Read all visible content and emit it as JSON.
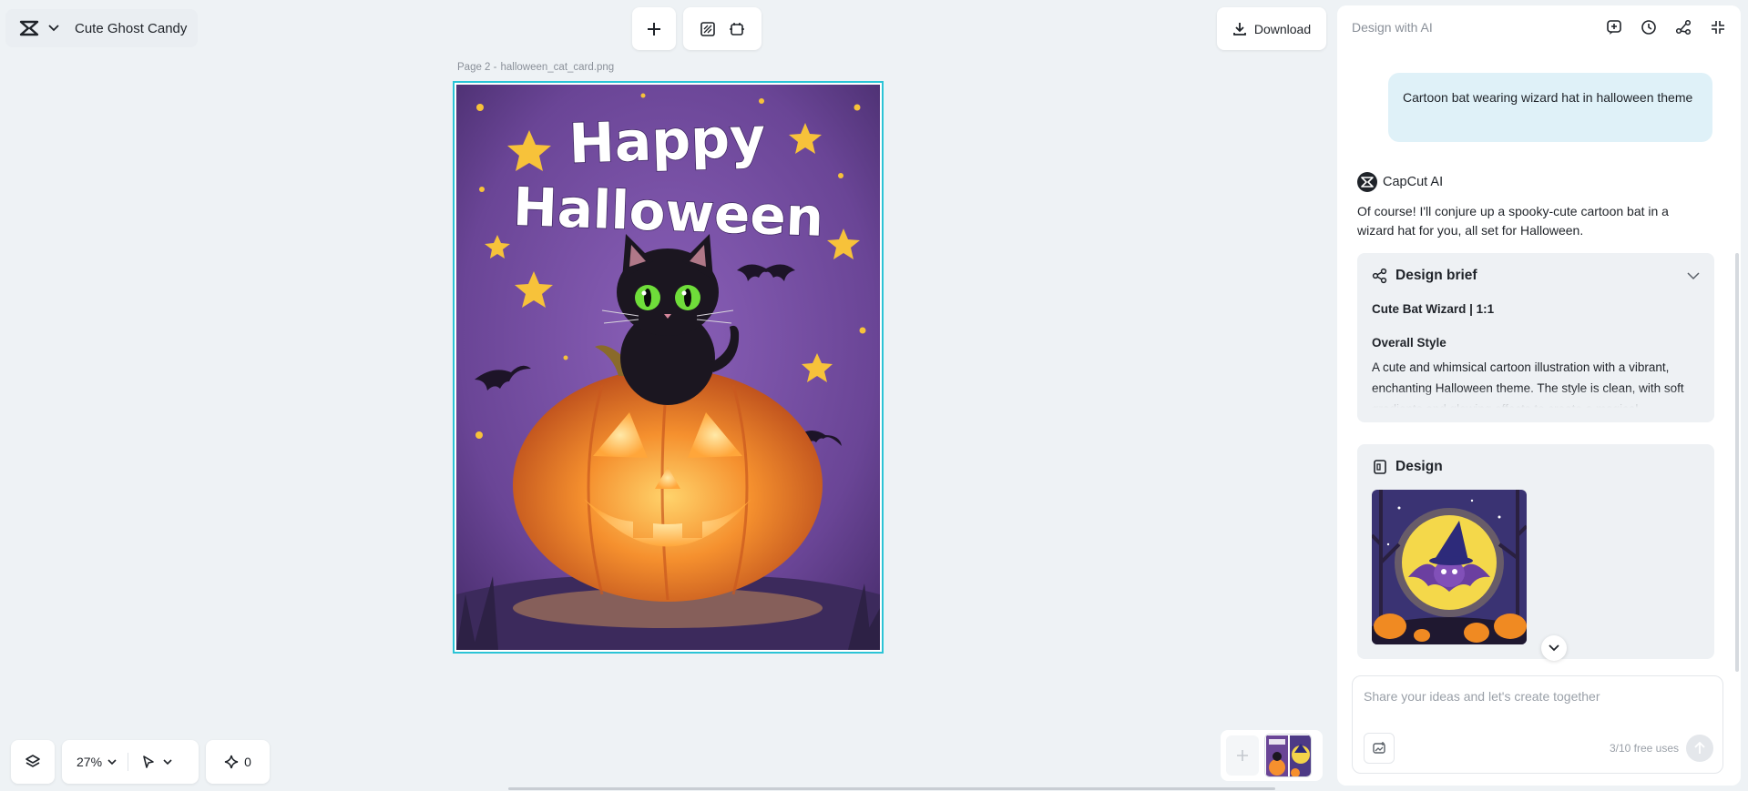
{
  "header": {
    "project_name": "Cute Ghost Candy",
    "logo_icon": "capcut-logo-icon",
    "download_label": "Download"
  },
  "toolbar": {
    "add_icon": "plus-icon",
    "icons": [
      "resize-icon",
      "crop-icon"
    ]
  },
  "canvas": {
    "page_label": "Page 2 -",
    "file_name": "halloween_cat_card.png",
    "artwork_title": [
      "Happy",
      "Halloween"
    ],
    "selection_color": "#2bc4d6"
  },
  "bottom_bar": {
    "zoom": "27%",
    "ai_count": "0"
  },
  "panel": {
    "title": "Design with AI",
    "header_icons": [
      "new-chat-icon",
      "history-icon",
      "share-icon",
      "collapse-icon"
    ],
    "user_message": "Cartoon bat wearing wizard hat in halloween theme",
    "ai_name": "CapCut AI",
    "ai_reply": "Of course! I'll conjure up a spooky-cute cartoon bat in a wizard hat for you, all set for Halloween.",
    "brief": {
      "title": "Design brief",
      "subtitle": "Cute Bat Wizard | 1:1",
      "section": "Overall Style",
      "body": "A cute and whimsical cartoon illustration with a vibrant, enchanting Halloween theme. The style is clean, with soft gradients and glowing effects to create a magical"
    },
    "design": {
      "title": "Design"
    },
    "composer": {
      "placeholder": "Share your ideas and let's create together",
      "uses": "3/10 free uses"
    }
  }
}
